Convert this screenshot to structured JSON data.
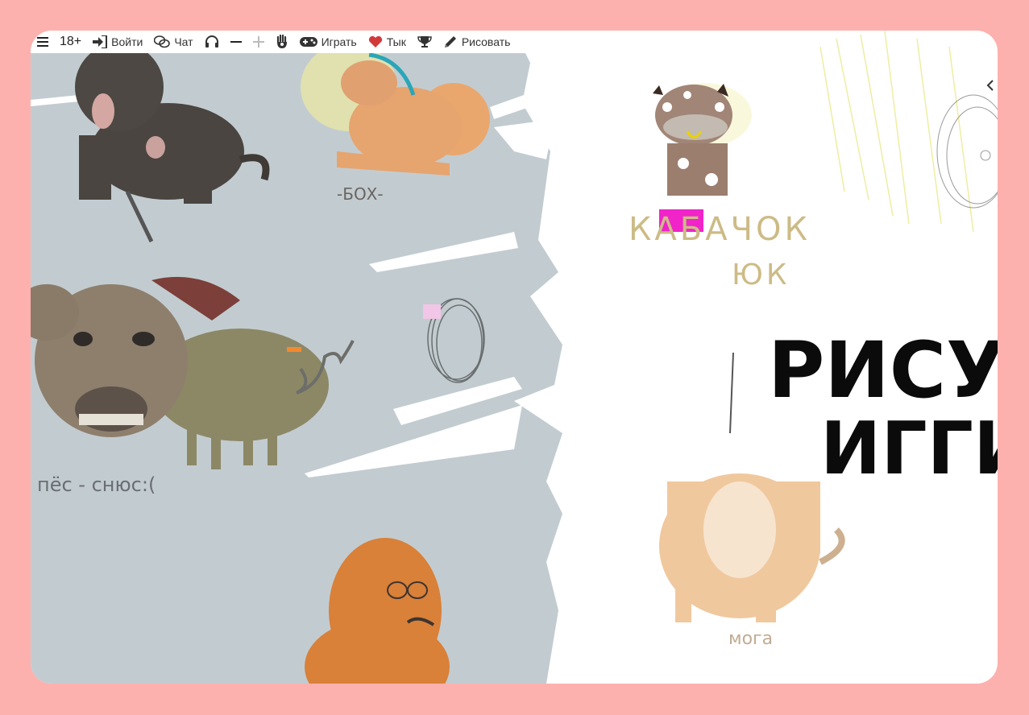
{
  "toolbar": {
    "age_label": "18+",
    "login_label": "Войти",
    "chat_label": "Чат",
    "play_label": "Играть",
    "poke_label": "Тык",
    "draw_label": "Рисовать"
  },
  "canvas": {
    "labels": {
      "box": "-БОХ-",
      "pes": "пёс - снюс:(",
      "kabachok": "КАБАЧОК",
      "ok": "ЮК",
      "moga": "мога",
      "big_line1": "РИСУЕ",
      "big_line2": "ИГГИ"
    }
  },
  "colors": {
    "background": "#fdb1ae",
    "canvas_gray": "#c2ccd0",
    "canvas_white": "#ffffff",
    "heart": "#d23a3a"
  },
  "icons": [
    "menu-icon",
    "login-icon",
    "chat-icon",
    "headphones-icon",
    "zoom-out-icon",
    "zoom-in-icon",
    "hand-icon",
    "gamepad-icon",
    "heart-icon",
    "trophy-icon",
    "pencil-icon",
    "chevron-left-icon"
  ]
}
